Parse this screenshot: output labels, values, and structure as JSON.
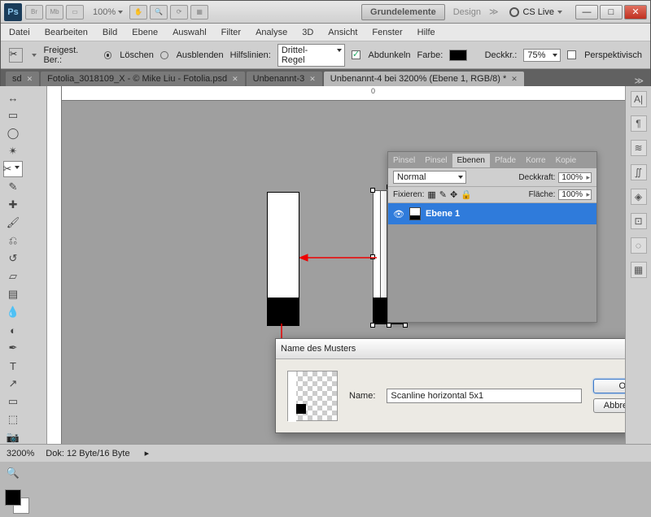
{
  "titlebar": {
    "ps": "Ps",
    "badges": [
      "Br",
      "Mb"
    ],
    "zoom": "100%",
    "workspace_primary": "Grundelemente",
    "workspace_secondary": "Design",
    "chevron": "≫",
    "cslive": "CS Live"
  },
  "window_buttons": {
    "min": "—",
    "max": "□",
    "close": "✕"
  },
  "menubar": [
    "Datei",
    "Bearbeiten",
    "Bild",
    "Ebene",
    "Auswahl",
    "Filter",
    "Analyse",
    "3D",
    "Ansicht",
    "Fenster",
    "Hilfe"
  ],
  "optbar": {
    "label": "Freigest. Ber.:",
    "opt1": "Löschen",
    "opt2": "Ausblenden",
    "guides_label": "Hilfslinien:",
    "guides_value": "Drittel-Regel",
    "darken": "Abdunkeln",
    "color_label": "Farbe:",
    "opacity_label": "Deckkr.:",
    "opacity_value": "75%",
    "perspective": "Perspektivisch"
  },
  "tabs": [
    {
      "label": "sd",
      "active": false
    },
    {
      "label": "Fotolia_3018109_X - © Mike Liu - Fotolia.psd",
      "active": false
    },
    {
      "label": "Unbenannt-3",
      "active": false
    },
    {
      "label": "Unbenannt-4 bei 3200% (Ebene 1, RGB/8) *",
      "active": true
    }
  ],
  "tabs_more": "≫",
  "ruler_zero": "0",
  "layers_panel": {
    "tabs": [
      "Pinsel",
      "Pinsel",
      "Ebenen",
      "Pfade",
      "Korre",
      "Kopie"
    ],
    "active_tab": "Ebenen",
    "mode": "Normal",
    "opacity_label": "Deckkraft:",
    "opacity": "100%",
    "lock_label": "Fixieren:",
    "fill_label": "Fläche:",
    "fill": "100%",
    "layer_name": "Ebene 1"
  },
  "dialog": {
    "title": "Name des Musters",
    "name_label": "Name:",
    "name_value": "Scanline horizontal 5x1",
    "ok": "OK",
    "cancel": "Abbrechen"
  },
  "status": {
    "zoom": "3200%",
    "doc": "Dok: 12 Byte/16 Byte"
  },
  "right_icons": [
    "A|",
    "¶",
    "≋",
    "∬",
    "◈",
    "⊡",
    "◌",
    "▦"
  ]
}
